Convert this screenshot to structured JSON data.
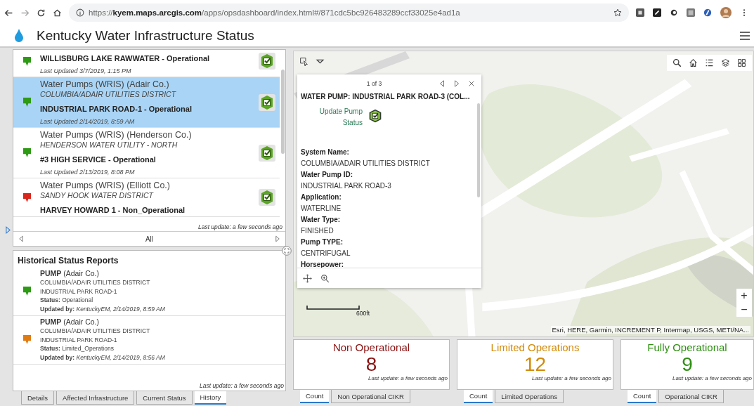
{
  "browser": {
    "url": "https://**kyem.maps.arcgis.com**/apps/opsdashboard/index.html#/871cdc5bc926483289ccf33025e4ad1a"
  },
  "header": {
    "title": "Kentucky Water Infrastructure Status"
  },
  "list": {
    "items": [
      {
        "name": "WILLISBURG LAKE RAWWATER - Operational",
        "updated": "Last Updated 3/7/2019, 1:15 PM",
        "color": "#2e9a16",
        "selected": false
      },
      {
        "layer": "Water Pumps (WRIS) (Adair Co.)",
        "system": "COLUMBIA/ADAIR UTILITIES DISTRICT",
        "name": "INDUSTRIAL PARK ROAD-1 - Operational",
        "updated": "Last Updated 2/14/2019, 8:59 AM",
        "color": "#2e9a16",
        "selected": true
      },
      {
        "layer": "Water Pumps (WRIS) (Henderson Co.)",
        "system": "HENDERSON WATER UTILITY - NORTH",
        "name": "#3 HIGH SERVICE - Operational",
        "updated": "Last Updated 2/13/2019, 8:08 PM",
        "color": "#2e9a16",
        "selected": false
      },
      {
        "layer": "Water Pumps (WRIS) (Elliott Co.)",
        "system": "SANDY HOOK WATER DISTRICT",
        "name": "HARVEY HOWARD 1 - Non_Operational",
        "color": "#d9261c",
        "selected": false
      }
    ],
    "last_update": "Last update: a few seconds ago",
    "filter": "All"
  },
  "history": {
    "title": "Historical Status Reports",
    "reports": [
      {
        "heading": "**PUMP** (Adair Co.)",
        "system": "COLUMBIA/ADAIR UTILITIES DISTRICT",
        "name": "INDUSTRIAL PARK ROAD-1",
        "status": "**Status:** Operational",
        "updated": "**Updated by:** *KentuckyEM, 2/14/2019, 8:59 AM*",
        "color": "#2e9a16"
      },
      {
        "heading": "**PUMP** (Adair Co.)",
        "system": "COLUMBIA/ADAIR UTILITIES DISTRICT",
        "name": "INDUSTRIAL PARK ROAD-1",
        "status": "**Status:** Limited_Operations",
        "updated": "**Updated by:** *KentuckyEM, 2/14/2019, 8:56 AM*",
        "color": "#e07b12"
      }
    ],
    "last_update": "Last update: a few seconds ago"
  },
  "left_tabs": [
    {
      "label": "Details",
      "selected": false
    },
    {
      "label": "Affected Infrastructure",
      "selected": false
    },
    {
      "label": "Current Status",
      "selected": false
    },
    {
      "label": "History",
      "selected": true
    }
  ],
  "map": {
    "popup": {
      "pager": "1 of 3",
      "title": "WATER PUMP: INDUSTRIAL PARK ROAD-3 (COL...",
      "action": "Update Pump Status",
      "fields": [
        {
          "label": "System Name:",
          "value": "COLUMBIA/ADAIR UTILITIES DISTRICT"
        },
        {
          "label": "Water Pump ID:",
          "value": "INDUSTRIAL PARK ROAD-3"
        },
        {
          "label": "Application:",
          "value": "WATERLINE"
        },
        {
          "label": "Water Type:",
          "value": "FINISHED"
        },
        {
          "label": "Pump TYPE:",
          "value": "CENTRIFUGAL"
        },
        {
          "label": "Horsepower:"
        }
      ]
    },
    "scale": "600ft",
    "attribution": "Esri, HERE, Garmin, INCREMENT P, Intermap, USGS, METI/NA...",
    "zoom": [
      "+",
      "−"
    ]
  },
  "indicators": [
    {
      "title": "Non Operational",
      "value": "8",
      "color": "#8a1111",
      "last_update": "Last update: a few seconds ago",
      "tabs": [
        {
          "label": "Count",
          "selected": true
        },
        {
          "label": "Non Operational CIKR",
          "selected": false
        }
      ]
    },
    {
      "title": "Limited Operations",
      "value": "12",
      "color": "#d28a0a",
      "last_update": "Last update: a few seconds ago",
      "tabs": [
        {
          "label": "Count",
          "selected": true
        },
        {
          "label": "Limited Operations",
          "selected": false
        }
      ]
    },
    {
      "title": "Fully Operational",
      "value": "9",
      "color": "#2f8f13",
      "last_update": "Last update: a few seconds ago",
      "tabs": [
        {
          "label": "Count",
          "selected": true
        },
        {
          "label": "Operational CIKR",
          "selected": false
        }
      ]
    }
  ]
}
